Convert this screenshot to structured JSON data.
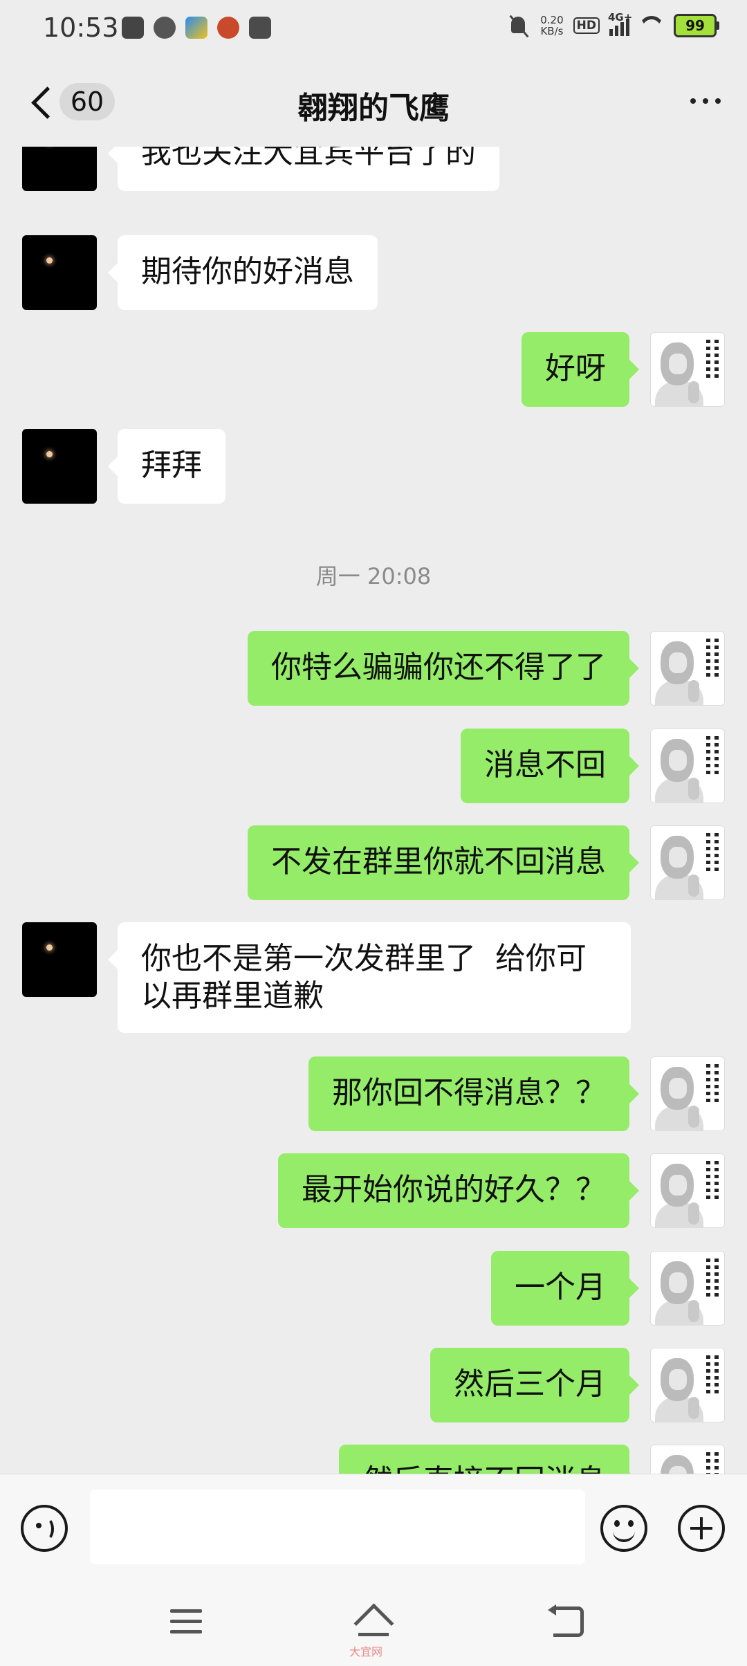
{
  "status_bar": {
    "time": "10:53",
    "speed_value": "0.20",
    "speed_unit": "KB/s",
    "hd": "HD",
    "network": "4G+",
    "battery": "99"
  },
  "header": {
    "unread_count": "60",
    "title": "翱翔的飞鹰"
  },
  "messages": [
    {
      "from": "other",
      "text": "我也关注大宜宾平台了的"
    },
    {
      "from": "other",
      "text": "期待你的好消息"
    },
    {
      "from": "me",
      "text": "好呀"
    },
    {
      "from": "other",
      "text": "拜拜"
    },
    {
      "timestamp": "周一 20:08"
    },
    {
      "from": "me",
      "text": "你特么骗骗你还不得了了"
    },
    {
      "from": "me",
      "text": "消息不回"
    },
    {
      "from": "me",
      "text": "不发在群里你就不回消息"
    },
    {
      "from": "other",
      "text": "你也不是第一次发群里了  给你可\n以再群里道歉"
    },
    {
      "from": "me",
      "text": "那你回不得消息？？"
    },
    {
      "from": "me",
      "text": "最开始你说的好久？？"
    },
    {
      "from": "me",
      "text": "一个月"
    },
    {
      "from": "me",
      "text": "然后三个月"
    },
    {
      "from": "me",
      "text": "然后直接不回消息"
    }
  ],
  "input": {
    "value": ""
  },
  "nav": {
    "watermark": "大宜网"
  }
}
